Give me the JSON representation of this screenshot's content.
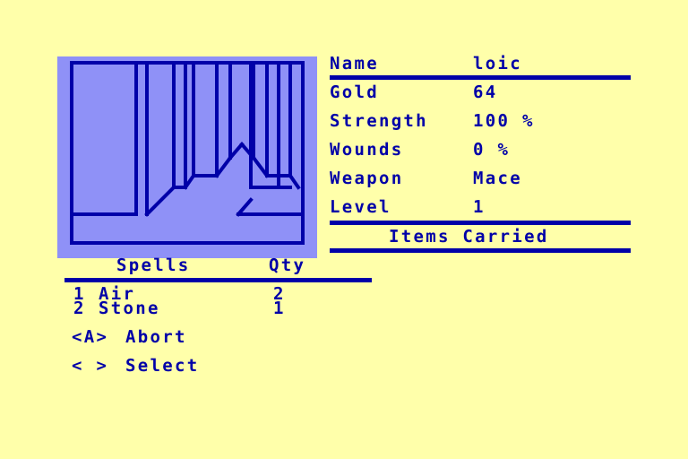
{
  "screen": {
    "background_color": "#ffffaa",
    "ink_color": "#0000a8",
    "viewport_fill_color": "#8f91f7"
  },
  "viewport": {
    "name": "dungeon-corridor-view",
    "description": "first-person wireframe dungeon corridor"
  },
  "stats": {
    "rows": [
      {
        "label": "Name",
        "value": "loic"
      },
      {
        "label": "Gold",
        "value": "64"
      },
      {
        "label": "Strength",
        "value": "100 %"
      },
      {
        "label": "Wounds",
        "value": "0 %"
      },
      {
        "label": "Weapon",
        "value": "Mace"
      },
      {
        "label": "Level",
        "value": "1"
      }
    ],
    "items_carried_header": "Items Carried"
  },
  "spells": {
    "header_name": "Spells",
    "header_qty": "Qty",
    "rows": [
      {
        "index": "1",
        "name": "Air",
        "qty": "2"
      },
      {
        "index": "2",
        "name": "Stone",
        "qty": "1"
      }
    ]
  },
  "commands": [
    {
      "key": "<A>",
      "label": "Abort"
    },
    {
      "key": "< >",
      "label": "Select"
    }
  ]
}
